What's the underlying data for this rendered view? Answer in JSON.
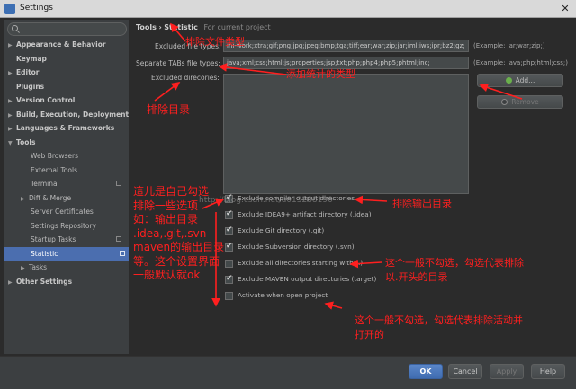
{
  "window": {
    "title": "Settings",
    "close_glyph": "✕"
  },
  "search": {
    "value": "",
    "placeholder": ""
  },
  "sidebar": {
    "items": [
      {
        "label": "Appearance & Behavior",
        "arrow": "▶"
      },
      {
        "label": "Keymap",
        "arrow": ""
      },
      {
        "label": "Editor",
        "arrow": "▶"
      },
      {
        "label": "Plugins",
        "arrow": ""
      },
      {
        "label": "Version Control",
        "arrow": "▶"
      },
      {
        "label": "Build, Execution, Deployment",
        "arrow": "▶"
      },
      {
        "label": "Languages & Frameworks",
        "arrow": "▶"
      },
      {
        "label": "Tools",
        "arrow": "▼"
      },
      {
        "label": "Web Browsers",
        "arrow": ""
      },
      {
        "label": "External Tools",
        "arrow": ""
      },
      {
        "label": "Terminal",
        "arrow": ""
      },
      {
        "label": "Diff & Merge",
        "arrow": "▶"
      },
      {
        "label": "Server Certificates",
        "arrow": ""
      },
      {
        "label": "Settings Repository",
        "arrow": ""
      },
      {
        "label": "Startup Tasks",
        "arrow": ""
      },
      {
        "label": "Statistic",
        "arrow": ""
      },
      {
        "label": "Tasks",
        "arrow": "▶"
      },
      {
        "label": "Other Settings",
        "arrow": "▶"
      }
    ]
  },
  "breadcrumb": {
    "parent": "Tools",
    "separator": "›",
    "current": "Statistic",
    "scope": "For current project"
  },
  "form": {
    "excluded_file_types_label": "Excluded file types:",
    "excluded_file_types_value": "ini-work;xtra;gif;png;jpg;jpeg;bmp;tga;tiff;ear;war;zip;jar;iml;iws;ipr;bz2;gz;",
    "excluded_file_types_hint": "(Example: jar;war;zip;)",
    "separate_tabs_label": "Separate TABs file types:",
    "separate_tabs_value": "java;xml;css;html;js;properties;jsp;txt;php;php4;php5;phtml;inc;",
    "separate_tabs_hint": "(Example: java;php;html;css;)",
    "excluded_dirs_label": "Excluded direcories:",
    "add_button": "Add...",
    "remove_button": "Remove"
  },
  "options": [
    {
      "label": "Exclude compiler output directories",
      "checked": true
    },
    {
      "label": "Exclude IDEA9+ artifact directory (.idea)",
      "checked": true
    },
    {
      "label": "Exclude Git directory (.git)",
      "checked": true
    },
    {
      "label": "Exclude Subversion directory (.svn)",
      "checked": true
    },
    {
      "label": "Exclude all directories starting with (.)",
      "checked": false
    },
    {
      "label": "Exclude MAVEN output directories (target)",
      "checked": true
    },
    {
      "label": "Activate when open project",
      "checked": false
    }
  ],
  "footer": {
    "ok": "OK",
    "cancel": "Cancel",
    "apply": "Apply",
    "help": "Help"
  },
  "annotations": {
    "exclude_file_types": "排除文件类型",
    "add_count_types": "添加统计的类型",
    "exclude_dirs": "排除目录",
    "exclude_output_dirs": "排除输出目录",
    "self_check_lines": [
      "這儿是自己勾选",
      "排除一些选项",
      "如：输出目录",
      ".idea,.git,.svn",
      "maven的输出目录",
      "等。这个设置界面",
      "一般默认就ok"
    ],
    "dot_dirs_lines": [
      "这个一般不勾选，勾选代表排除",
      "以.开头的目录"
    ],
    "activate_lines": [
      "这个一般不勾选，勾选代表排除活动并",
      "打开的"
    ],
    "watermark": "http://blog.csdn.net/u013288190"
  },
  "colors": {
    "annotation": "#ff1f1f",
    "selection": "#4b6eaf",
    "ok_button": "#4a78bd",
    "add_icon": "#6ab04c",
    "remove_icon": "#888888"
  }
}
